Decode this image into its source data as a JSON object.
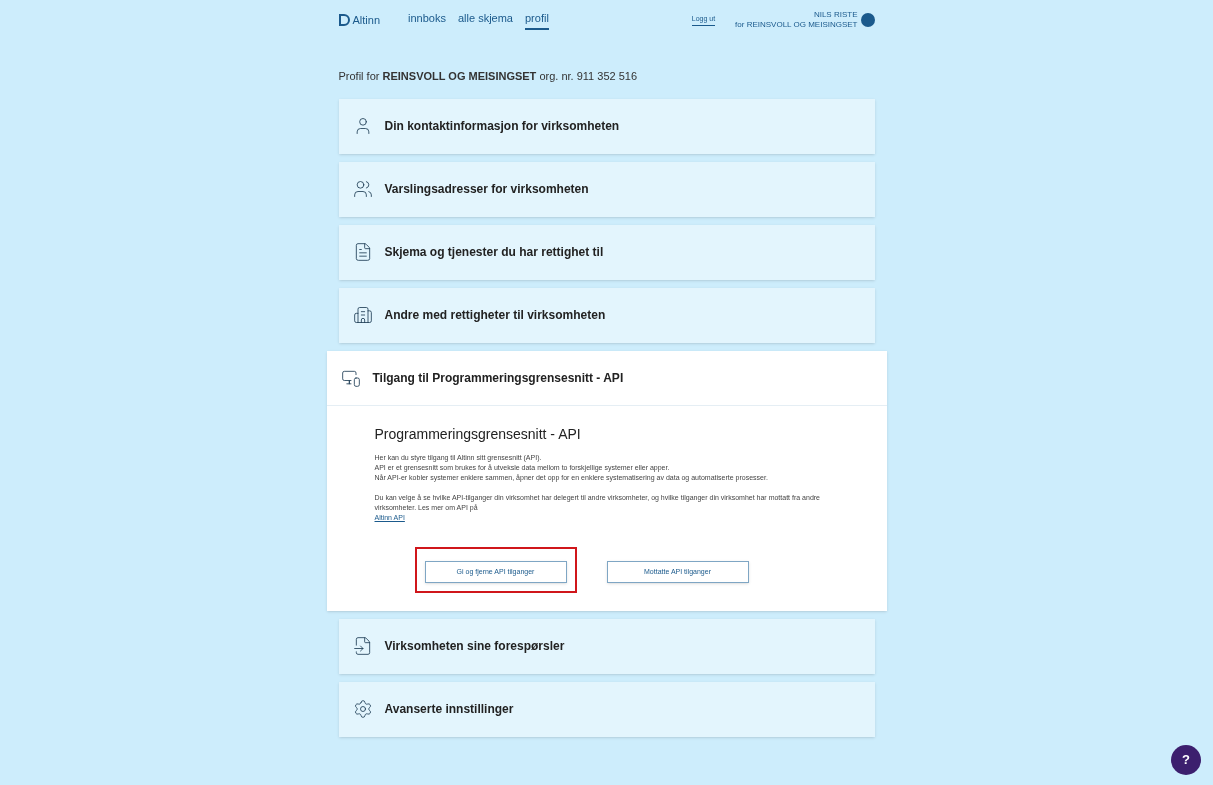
{
  "header": {
    "logo": "Altinn",
    "nav": [
      {
        "label": "innboks",
        "selected": false
      },
      {
        "label": "alle skjema",
        "selected": false
      },
      {
        "label": "profil",
        "selected": true
      }
    ],
    "logout": "Logg ut",
    "user": {
      "name": "NILS RISTE",
      "org": "for REINSVOLL OG MEISINGSET"
    }
  },
  "profile_line": "Profil for **REINSVOLL OG MEISINGSET** org. nr. 911 352 516",
  "sections": [
    {
      "kind": "user",
      "title": "Din kontaktinformasjon for virksomheten",
      "expanded": false
    },
    {
      "kind": "users",
      "title": "Varslingsadresser for virksomheten",
      "expanded": false
    },
    {
      "kind": "form",
      "title": "Skjema og tjenester du har rettighet til",
      "expanded": false
    },
    {
      "kind": "building",
      "title": "Andre med rettigheter til virksomheten",
      "expanded": false
    },
    {
      "kind": "api",
      "title": "Tilgang til Programmeringsgrensesnitt - API",
      "expanded": true,
      "body": {
        "heading": "Programmeringsgrensesnitt - API",
        "paragraphs": [
          "Her kan du styre tilgang til Altinn sitt grensesnitt (API).",
          "API er et grensesnitt som brukes for å utveksle data mellom to forskjellige systemer eller apper.",
          "Når API-er kobler systemer enklere sammen, åpner det opp for en enklere systematisering av data og automatiserte prosesser."
        ],
        "note": "Du kan velge å se hvilke API-tilganger din virksomhet har delegert til andre virksomheter, og hvilke tilganger din virksomhet har mottatt fra andre virksomheter. Les mer om API på",
        "link": "Altinn API",
        "buttons": [
          {
            "label": "Gi og fjerne API tilganger",
            "highlighted": true
          },
          {
            "label": "Mottatte API tilganger",
            "highlighted": false
          }
        ]
      }
    },
    {
      "kind": "requests",
      "title": "Virksomheten sine forespørsler",
      "expanded": false
    },
    {
      "kind": "settings",
      "title": "Avanserte innstillinger",
      "expanded": false
    }
  ],
  "help": "?"
}
